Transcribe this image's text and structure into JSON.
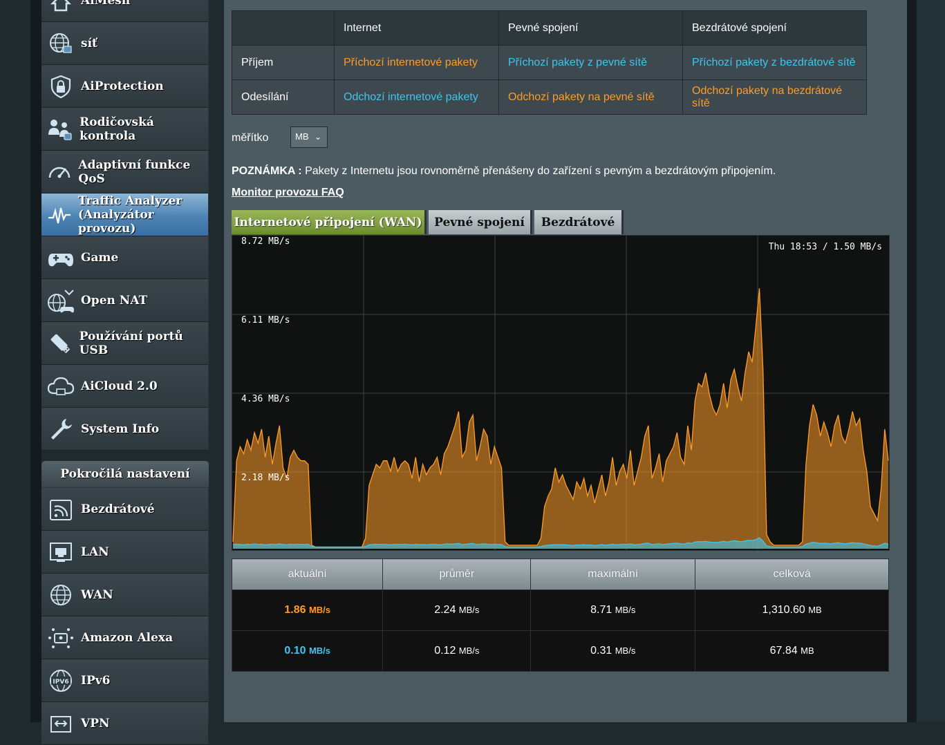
{
  "sidebar": {
    "items": [
      {
        "label": "AiMesh",
        "icon": "aimesh-icon"
      },
      {
        "label": "síť",
        "icon": "globe-network-icon"
      },
      {
        "label": "AiProtection",
        "icon": "shield-lock-icon"
      },
      {
        "label": "Rodičovská kontrola",
        "icon": "parental-family-icon"
      },
      {
        "label": "Adaptivní funkce QoS",
        "icon": "speedometer-icon"
      },
      {
        "label": "Traffic Analyzer (Analyzátor provozu)",
        "icon": "traffic-pulse-icon"
      },
      {
        "label": "Game",
        "icon": "gamepad-icon"
      },
      {
        "label": "Open NAT",
        "icon": "open-nat-icon"
      },
      {
        "label": "Používání portů USB",
        "icon": "usb-icon"
      },
      {
        "label": "AiCloud 2.0",
        "icon": "cloud-icon"
      },
      {
        "label": "System Info",
        "icon": "wrench-icon"
      }
    ],
    "advanced_header": "Pokročilá nastavení",
    "advanced_items": [
      {
        "label": "Bezdrátové",
        "icon": "wireless-icon"
      },
      {
        "label": "LAN",
        "icon": "lan-icon"
      },
      {
        "label": "WAN",
        "icon": "wan-globe-icon"
      },
      {
        "label": "Amazon Alexa",
        "icon": "alexa-icon"
      },
      {
        "label": "IPv6",
        "icon": "ipv6-icon"
      },
      {
        "label": "VPN",
        "icon": "vpn-icon"
      }
    ]
  },
  "legend": {
    "headers": [
      "",
      "Internet",
      "Pevné spojení",
      "Bezdrátové spojení"
    ],
    "rows": [
      {
        "label": "Příjem",
        "cells": [
          "Příchozí internetové pakety",
          "Příchozí pakety z pevné sítě",
          "Příchozí pakety z bezdrátové sítě"
        ],
        "colors": [
          "orange",
          "blue",
          "blue"
        ]
      },
      {
        "label": "Odesílání",
        "cells": [
          "Odchozí internetové pakety",
          "Odchozí pakety na pevné sítě",
          "Odchozí pakety na bezdrátové sítě"
        ],
        "colors": [
          "blue",
          "orange",
          "orange"
        ]
      }
    ]
  },
  "scale": {
    "label": "měřítko",
    "value": "MB"
  },
  "note": {
    "prefix": "POZNÁMKA :",
    "text": " Pakety z Internetu jsou rovnoměrně přenášeny do zařízení s pevným a bezdrátovým připojením."
  },
  "faq_link": "Monitor provozu FAQ",
  "tabs": [
    "Internetové připojení (WAN)",
    "Pevné spojení",
    "Bezdrátové"
  ],
  "chart_data": {
    "type": "area",
    "title": "",
    "xlabel": "",
    "ylabel": "",
    "stamp": "Thu 18:53 / 1.50 MB/s",
    "y_ticks": [
      "8.72 MB/s",
      "6.11 MB/s",
      "4.36 MB/s",
      "2.18 MB/s"
    ],
    "ylim": [
      0,
      8.72
    ],
    "grid": true,
    "colors": {
      "rx": "#ff9c26",
      "tx": "#3fc6f0"
    },
    "series": [
      {
        "values": [
          0.2,
          2.5,
          2.9,
          2.7,
          3.1,
          2.8,
          3.3,
          3.0,
          3.4,
          2.6,
          3.2,
          2.4,
          3.0,
          3.5,
          2.3,
          2.0,
          2.6,
          2.8,
          2.6,
          2.5,
          2.5,
          2.4,
          0.1,
          0.05,
          0.05,
          0.05,
          0.05,
          0.05,
          0.05,
          0.05,
          0.05,
          0.05,
          0.05,
          0.05,
          0.05,
          0.05,
          0.05,
          0.3,
          1.8,
          2.1,
          2.4,
          2.3,
          2.5,
          2.5,
          2.2,
          2.6,
          2.2,
          2.4,
          2.5,
          2.4,
          2.0,
          2.6,
          1.9,
          2.4,
          2.1,
          2.3,
          2.4,
          2.6,
          2.1,
          2.7,
          2.9,
          3.2,
          3.5,
          3.9,
          2.6,
          2.8,
          3.6,
          3.8,
          2.5,
          2.9,
          3.4,
          3.2,
          2.4,
          2.9,
          2.6,
          2.3,
          0.2,
          0.1,
          0.1,
          0.1,
          0.1,
          0.1,
          0.1,
          0.1,
          0.1,
          0.1,
          0.3,
          1.2,
          1.5,
          1.7,
          2.3,
          1.9,
          2.1,
          1.8,
          1.6,
          1.4,
          1.9,
          1.7,
          2.0,
          1.5,
          1.8,
          1.3,
          1.7,
          2.1,
          1.5,
          1.9,
          2.6,
          1.8,
          2.2,
          2.4,
          2.0,
          2.8,
          1.8,
          2.2,
          2.6,
          3.2,
          3.5,
          2.0,
          2.3,
          2.7,
          1.9,
          2.5,
          2.7,
          2.9,
          3.3,
          2.6,
          2.4,
          3.5,
          2.8,
          4.2,
          4.7,
          4.6,
          5.0,
          4.4,
          4.0,
          3.8,
          4.1,
          4.7,
          4.0,
          4.8,
          5.1,
          4.6,
          4.2,
          5.0,
          5.6,
          5.3,
          6.3,
          7.4,
          5.1,
          0.4,
          0.2,
          0.1,
          0.1,
          0.1,
          0.1,
          0.1,
          0.1,
          0.1,
          0.1,
          0.2,
          2.4,
          3.5,
          4.1,
          3.8,
          3.2,
          3.6,
          3.3,
          2.9,
          3.5,
          3.8,
          3.2,
          3.0,
          3.4,
          3.9,
          3.5,
          3.7,
          2.8,
          2.2,
          1.2,
          1.0,
          0.8,
          1.7,
          3.4,
          2.5
        ]
      },
      {
        "values": [
          0.12,
          0.13,
          0.12,
          0.11,
          0.13,
          0.12,
          0.14,
          0.12,
          0.13,
          0.11,
          0.12,
          0.13,
          0.12,
          0.14,
          0.12,
          0.11,
          0.13,
          0.12,
          0.13,
          0.12,
          0.12,
          0.13,
          0.06,
          0.05,
          0.05,
          0.05,
          0.05,
          0.05,
          0.05,
          0.05,
          0.05,
          0.05,
          0.05,
          0.05,
          0.05,
          0.05,
          0.05,
          0.06,
          0.11,
          0.12,
          0.13,
          0.12,
          0.13,
          0.12,
          0.11,
          0.13,
          0.12,
          0.12,
          0.13,
          0.12,
          0.11,
          0.13,
          0.12,
          0.12,
          0.11,
          0.12,
          0.13,
          0.12,
          0.11,
          0.13,
          0.14,
          0.13,
          0.14,
          0.15,
          0.12,
          0.13,
          0.14,
          0.15,
          0.12,
          0.13,
          0.14,
          0.13,
          0.12,
          0.13,
          0.12,
          0.12,
          0.06,
          0.05,
          0.05,
          0.05,
          0.05,
          0.05,
          0.05,
          0.05,
          0.05,
          0.05,
          0.06,
          0.09,
          0.1,
          0.11,
          0.12,
          0.11,
          0.12,
          0.11,
          0.1,
          0.09,
          0.11,
          0.1,
          0.12,
          0.1,
          0.11,
          0.09,
          0.1,
          0.12,
          0.1,
          0.11,
          0.13,
          0.11,
          0.12,
          0.13,
          0.12,
          0.14,
          0.11,
          0.12,
          0.13,
          0.15,
          0.16,
          0.12,
          0.13,
          0.14,
          0.12,
          0.13,
          0.14,
          0.15,
          0.16,
          0.14,
          0.13,
          0.17,
          0.15,
          0.19,
          0.2,
          0.2,
          0.21,
          0.19,
          0.18,
          0.18,
          0.19,
          0.21,
          0.19,
          0.21,
          0.23,
          0.21,
          0.2,
          0.22,
          0.24,
          0.23,
          0.26,
          0.31,
          0.22,
          0.08,
          0.06,
          0.05,
          0.05,
          0.05,
          0.05,
          0.05,
          0.05,
          0.05,
          0.05,
          0.06,
          0.13,
          0.16,
          0.18,
          0.17,
          0.15,
          0.16,
          0.15,
          0.14,
          0.16,
          0.17,
          0.15,
          0.14,
          0.16,
          0.17,
          0.16,
          0.16,
          0.14,
          0.12,
          0.09,
          0.08,
          0.07,
          0.11,
          0.16,
          0.13
        ]
      }
    ]
  },
  "stats": {
    "headers": [
      "aktuální",
      "průměr",
      "maximální",
      "celková"
    ],
    "rows": [
      {
        "values": [
          "1.86",
          "2.24",
          "8.71",
          "1,310.60"
        ],
        "units": [
          "MB/s",
          "MB/s",
          "MB/s",
          "MB"
        ]
      },
      {
        "values": [
          "0.10",
          "0.12",
          "0.31",
          "67.84"
        ],
        "units": [
          "MB/s",
          "MB/s",
          "MB/s",
          "MB"
        ]
      }
    ]
  }
}
